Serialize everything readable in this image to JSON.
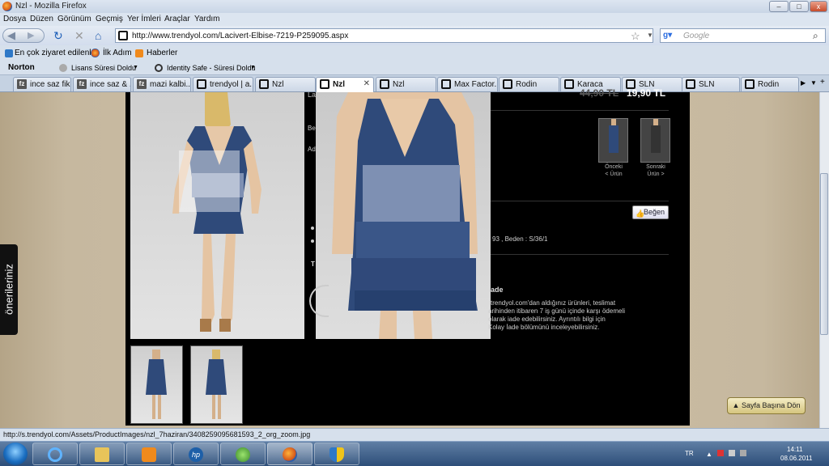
{
  "window": {
    "title": "Nzl - Mozilla Firefox",
    "min": "–",
    "max": "□",
    "close": "x"
  },
  "menu": [
    "Dosya",
    "Düzen",
    "Görünüm",
    "Geçmiş",
    "Yer İmleri",
    "Araçlar",
    "Yardım"
  ],
  "nav": {
    "url": "http://www.trendyol.com/Lacivert-Elbise-7219-P259095.aspx",
    "search_placeholder": "Google"
  },
  "bookmarks": [
    "En çok ziyaret edilenler",
    "İlk Adım",
    "Haberler"
  ],
  "norton": {
    "brand": "Norton",
    "items": [
      "Lisans Süresi Doldu",
      "Identity Safe - Süresi Doldu"
    ]
  },
  "tabs": [
    {
      "label": "ince saz fik...",
      "icon": "fz"
    },
    {
      "label": "ince saz & ...",
      "icon": "fz"
    },
    {
      "label": "mazi kalbi...",
      "icon": "fz"
    },
    {
      "label": "trendyol | a...",
      "icon": "t"
    },
    {
      "label": "Nzl",
      "icon": "t"
    },
    {
      "label": "Nzl",
      "icon": "t",
      "active": true
    },
    {
      "label": "Nzl",
      "icon": "t"
    },
    {
      "label": "Max Factor...",
      "icon": "t"
    },
    {
      "label": "Rodin",
      "icon": "t"
    },
    {
      "label": "Karaca",
      "icon": "t"
    },
    {
      "label": "SLN",
      "icon": "t"
    },
    {
      "label": "SLN",
      "icon": "t"
    },
    {
      "label": "Rodin",
      "icon": "t"
    }
  ],
  "product": {
    "old_price": "44,90 TL",
    "price": "19,90 TL",
    "size_info": "93 , Beden : S/36/1",
    "prev_label": "Önceki",
    "prev_sub": "< Ürün",
    "next_label": "Sonraki",
    "next_sub": "Ürün >",
    "like": "Beğen",
    "return_title": "ade",
    "return_lines": [
      "trendyol.com'dan aldığınız ürünleri, teslimat",
      "arihinden itibaren 7 iş günü içinde karşı ödemeli",
      "olarak iade edebilirsiniz. Ayrıntılı bilgi için",
      "Kolay İade bölümünü inceleyebilirsiniz."
    ],
    "left_labels": [
      "Be",
      "Ad",
      "T"
    ]
  },
  "sidebar_tab": "önerileriniz",
  "go_top": "Sayfa Başına Dön",
  "status": "http://s.trendyol.com/Assets/ProductImages/nzl_7haziran/3408259095681593_2_org_zoom.jpg",
  "tray": {
    "lang": "TR",
    "time": "14:11",
    "date": "08.06.2011"
  },
  "colors": {
    "dress": "#2f4a7a",
    "page_bg": "#000000",
    "side_bg": "#c6b89f"
  }
}
